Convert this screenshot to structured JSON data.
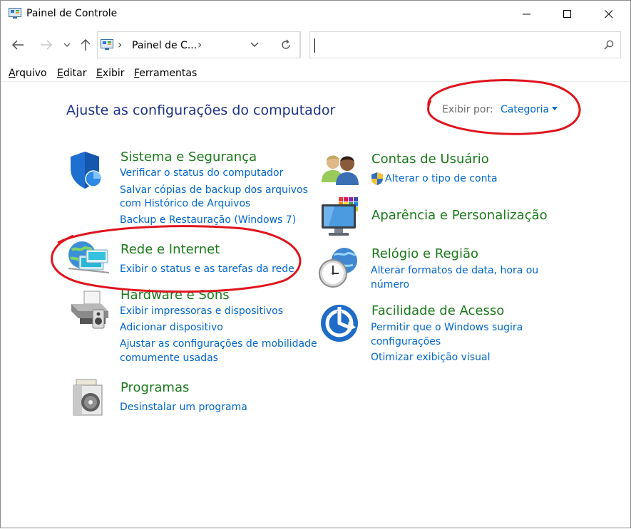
{
  "window": {
    "title": "Painel de Controle"
  },
  "address": {
    "crumb": "Painel de C...",
    "sep": "›"
  },
  "search": {
    "value": "",
    "placeholder": ""
  },
  "menu": {
    "items": [
      {
        "key": "A",
        "rest": "rquivo"
      },
      {
        "key": "E",
        "rest": "ditar"
      },
      {
        "key": "E",
        "rest": "xibir"
      },
      {
        "key": "F",
        "rest": "erramentas"
      }
    ]
  },
  "content": {
    "heading": "Ajuste as configurações do computador",
    "view_by_label": "Exibir por:",
    "view_by_value": "Categoria"
  },
  "categories": {
    "sistema": {
      "title": "Sistema e Segurança",
      "links": [
        "Verificar o status do computador",
        "Salvar cópias de backup dos arquivos",
        "com Histórico de Arquivos",
        "Backup e Restauração (Windows 7)"
      ]
    },
    "rede": {
      "title": "Rede e Internet",
      "links": [
        "Exibir o status e as tarefas da rede"
      ]
    },
    "hardware": {
      "title": "Hardware e Sons",
      "links": [
        "Exibir impressoras e dispositivos",
        "Adicionar dispositivo",
        "Ajustar as configurações de mobilidade",
        "comumente usadas"
      ]
    },
    "programas": {
      "title": "Programas",
      "links": [
        "Desinstalar um programa"
      ]
    },
    "contas": {
      "title": "Contas de Usuário",
      "links": [
        "Alterar o tipo de conta"
      ]
    },
    "aparencia": {
      "title": "Aparência e Personalização",
      "links": []
    },
    "relogio": {
      "title": "Relógio e Região",
      "links": [
        "Alterar formatos de data, hora ou",
        "número"
      ]
    },
    "facilidade": {
      "title": "Facilidade de Acesso",
      "links": [
        "Permitir que o Windows sugira",
        "configurações",
        "Otimizar exibição visual"
      ]
    }
  },
  "colors": {
    "heading": "#1e3287",
    "category_title": "#1a7a1a",
    "link": "#0066cc",
    "annotation": "#e0141e"
  }
}
